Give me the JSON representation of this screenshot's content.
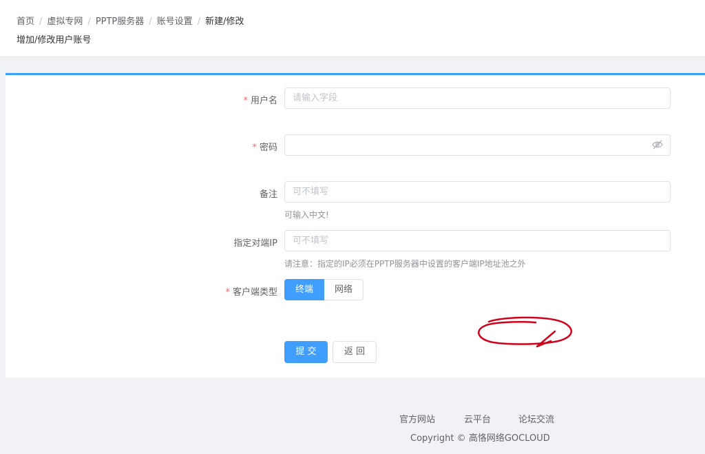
{
  "breadcrumb": [
    "首页",
    "虚拟专网",
    "PPTP服务器",
    "账号设置",
    "新建/修改"
  ],
  "page_title": "增加/修改用户账号",
  "form": {
    "username": {
      "label": "用户名",
      "required_mark": "*",
      "placeholder": "请输入字段"
    },
    "password": {
      "label": "密码",
      "required_mark": "*"
    },
    "remark": {
      "label": "备注",
      "placeholder": "可不填写",
      "hint": "可输入中文!"
    },
    "peer_ip": {
      "label": "指定对端IP",
      "placeholder": "可不填写",
      "hint": "请注意：指定的IP必须在PPTP服务器中设置的客户端IP地址池之外"
    },
    "client_type": {
      "label": "客户端类型",
      "required_mark": "*",
      "options": [
        "终端",
        "网络"
      ],
      "selected": "终端"
    },
    "submit_label": "提 交",
    "back_label": "返 回"
  },
  "footer": {
    "links": [
      "官方网站",
      "云平台",
      "论坛交流"
    ],
    "copyright": "Copyright",
    "copyright_symbol": "©",
    "company": "高恪网络GOCLOUD"
  },
  "colors": {
    "primary": "#409eff",
    "required": "#f56c6c",
    "annotation": "#d0021b"
  }
}
